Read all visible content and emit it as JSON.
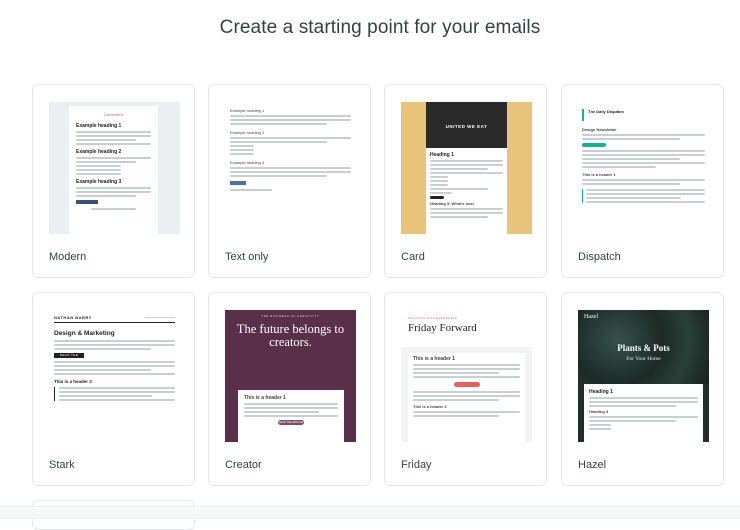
{
  "page": {
    "title": "Create a starting point for your emails"
  },
  "templates": [
    {
      "label": "Modern"
    },
    {
      "label": "Text only"
    },
    {
      "label": "Card"
    },
    {
      "label": "Dispatch"
    },
    {
      "label": "Stark"
    },
    {
      "label": "Creator"
    },
    {
      "label": "Friday"
    },
    {
      "label": "Hazel"
    }
  ],
  "previews": {
    "modern": {
      "logo": "ConvertKit",
      "h1": "Example heading 1",
      "h2": "Example heading 2",
      "h3": "Example heading 3"
    },
    "text_only": {
      "h1": "Example heading 1",
      "h2": "Example heading 2",
      "h3": "Example heading 3"
    },
    "card": {
      "hero": "UNITED WE EAT",
      "h1": "Heading 1",
      "h3": "Heading 3: What's next"
    },
    "dispatch": {
      "title": "The Daily Dispatch",
      "heading": "Design Newsletter",
      "header": "This is a header 1"
    },
    "stark": {
      "name": "NATHAN BARRY",
      "heading": "Design & Marketing",
      "button": "READ THE ARTICLE",
      "header": "This is a header 3"
    },
    "creator": {
      "kicker": "THE BUSINESS OF CREATIVITY",
      "headline": "The future belongs to creators.",
      "header": "This is a header 1",
      "button": "READ THE ARTICLE"
    },
    "friday": {
      "kicker": "LESSONS ON LEADERSHIP",
      "title": "Friday Forward",
      "header": "This is a header 1",
      "header3": "This is a header 3"
    },
    "hazel": {
      "name": "Hazel",
      "headline": "Plants & Pots",
      "subtitle": "For Your Home",
      "heading": "Heading 1",
      "heading3": "Heading 3"
    }
  }
}
